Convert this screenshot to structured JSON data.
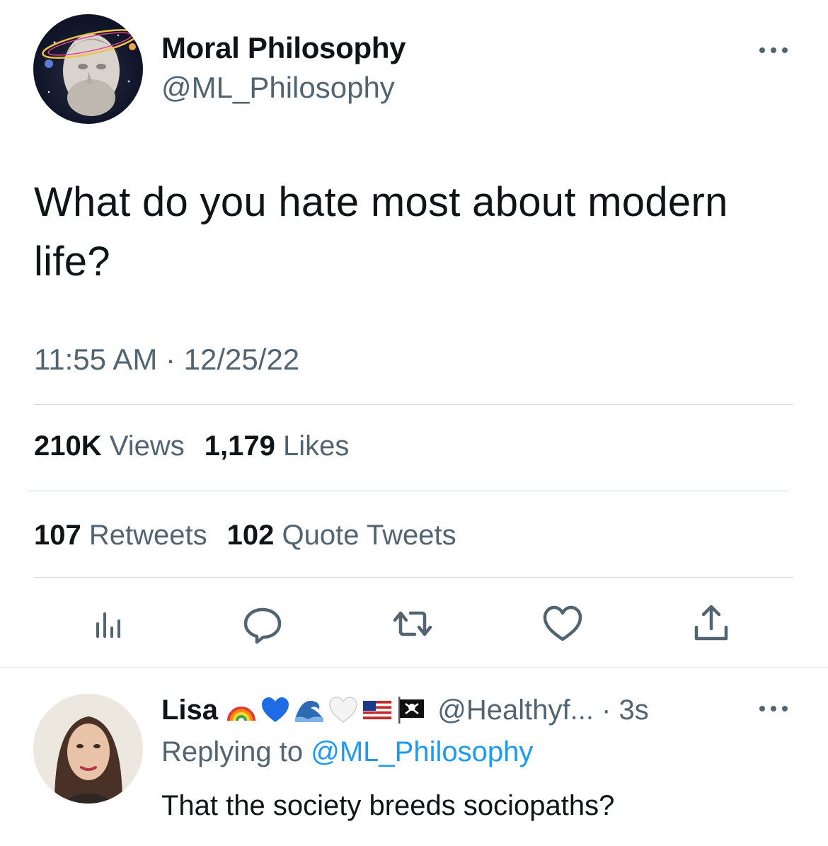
{
  "tweet": {
    "author": {
      "name": "Moral Philosophy",
      "handle": "@ML_Philosophy"
    },
    "text": "What do you hate most about modern life?",
    "time": "11:55 AM",
    "separator": " · ",
    "date": "12/25/22",
    "stats": {
      "views_count": "210K",
      "views_label": "Views",
      "likes_count": "1,179",
      "likes_label": "Likes",
      "retweets_count": "107",
      "retweets_label": "Retweets",
      "quotes_count": "102",
      "quotes_label": "Quote Tweets"
    }
  },
  "actions": [
    "analytics-icon",
    "reply-icon",
    "retweet-icon",
    "like-icon",
    "share-icon"
  ],
  "reply": {
    "name": "Lisa",
    "emojis": [
      "rainbow",
      "blue-heart",
      "wave",
      "white-heart",
      "us-flag",
      "pirate-flag"
    ],
    "handle": "@Healthyf...",
    "time": " · 3s",
    "replying_prefix": "Replying to ",
    "replying_to": "@ML_Philosophy",
    "text": "That the society breeds sociopaths?"
  },
  "colors": {
    "text": "#0f1419",
    "secondary": "#536471",
    "link": "#1d9bf0",
    "divider": "#cfd9de"
  }
}
